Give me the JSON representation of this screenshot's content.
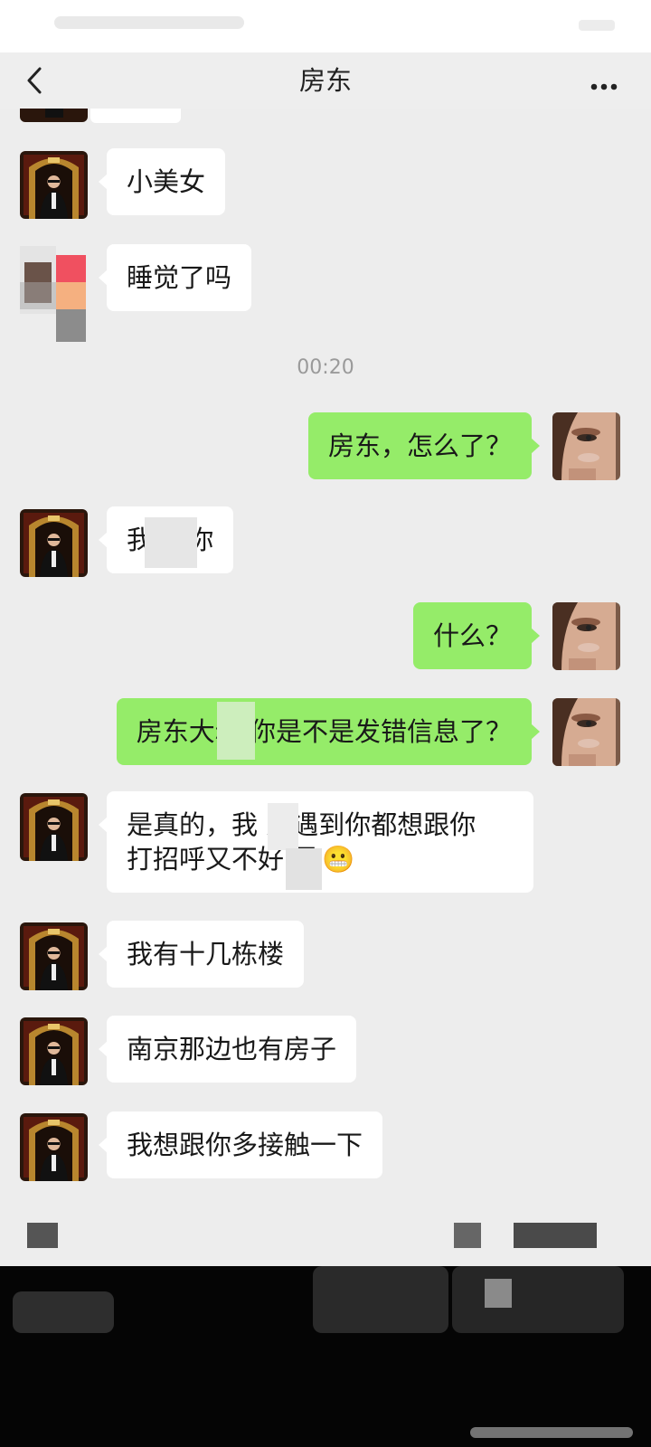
{
  "header": {
    "title": "房东",
    "back_icon": "chevron-left-icon",
    "more_icon": "ellipsis-icon"
  },
  "timestamp": "00:20",
  "messages": [
    {
      "side": "left",
      "text": "小美女"
    },
    {
      "side": "left",
      "text": "睡觉了吗"
    },
    {
      "side": "right",
      "text": "房东，怎么了？"
    },
    {
      "side": "left",
      "text": "我 欢你"
    },
    {
      "side": "right",
      "text": "什么？"
    },
    {
      "side": "right",
      "text": "房东大叔 你是不是发错信息了？"
    },
    {
      "side": "left",
      "line1": "是真的，我 天遇到你都想跟你",
      "line2": "打招呼又不好 思",
      "emoji": "😬"
    },
    {
      "side": "left",
      "text": "我有十几栋楼"
    },
    {
      "side": "left",
      "text": "南京那边也有房子"
    },
    {
      "side": "left",
      "text": "我想跟你多接触一下"
    }
  ],
  "colors": {
    "chat_bg": "#ededed",
    "left_bubble": "#ffffff",
    "right_bubble": "#95ec69",
    "header_bg": "#eeeeee"
  }
}
